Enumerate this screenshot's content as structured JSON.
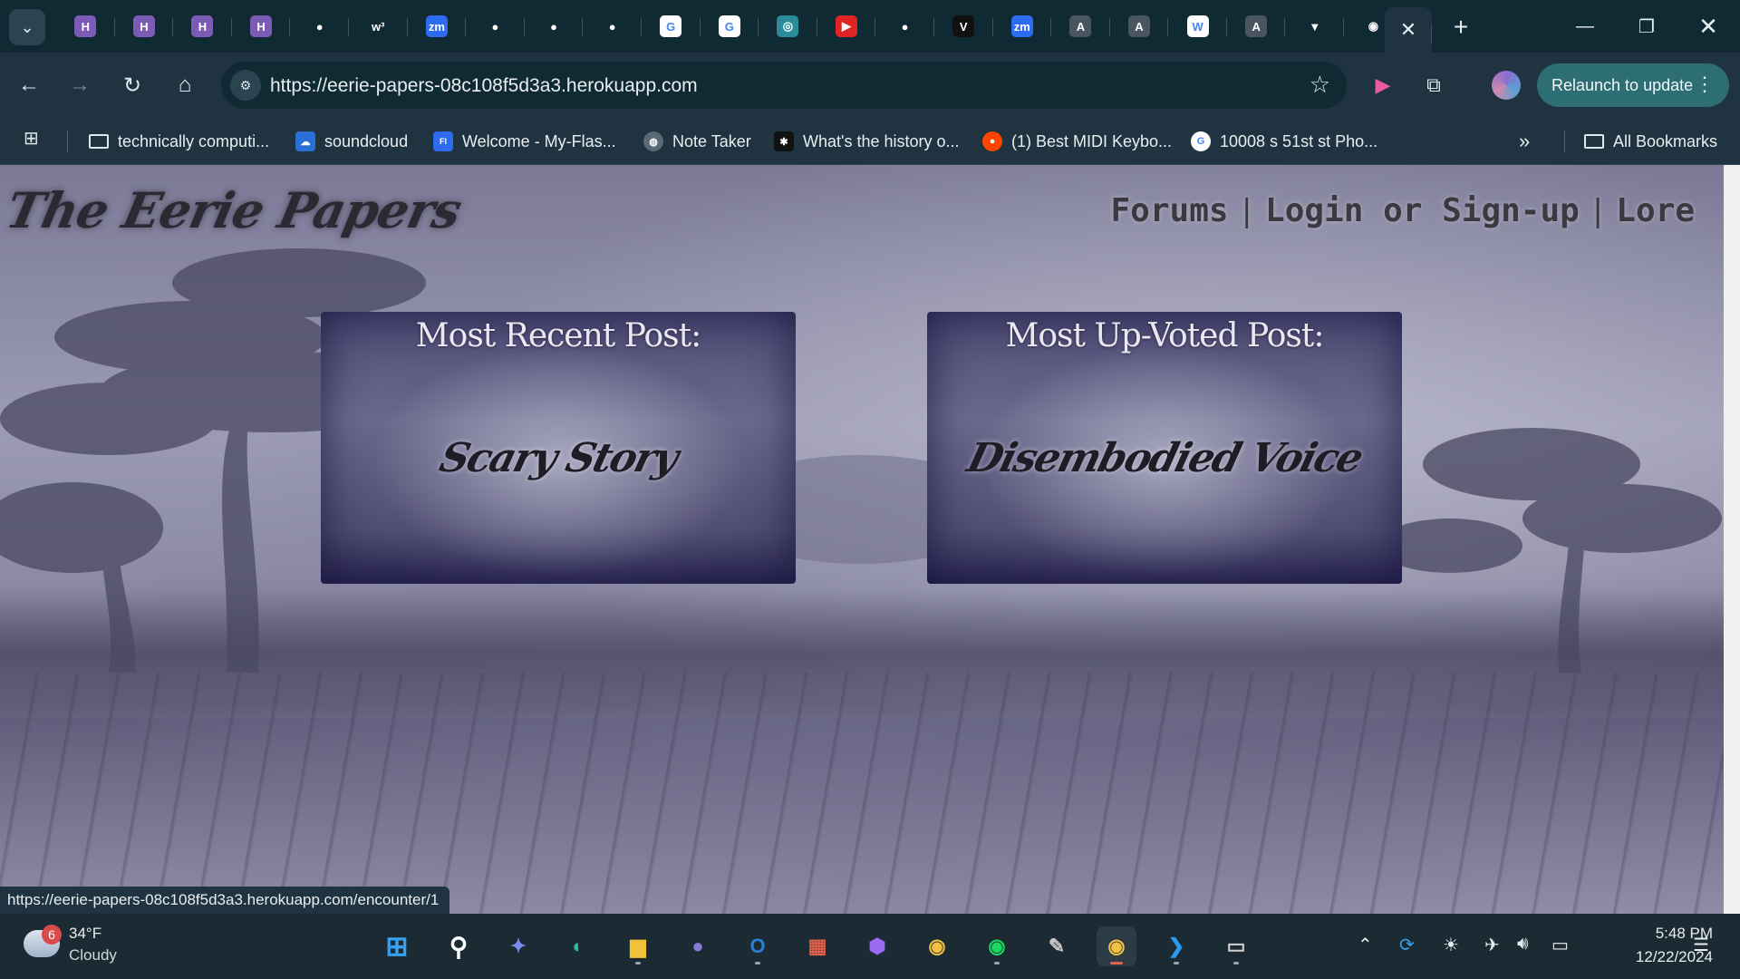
{
  "browser": {
    "tabs": [
      {
        "icon": "heroku-icon",
        "glyph": "H",
        "bg": "#7a5bb5"
      },
      {
        "icon": "heroku-icon",
        "glyph": "H",
        "bg": "#7a5bb5"
      },
      {
        "icon": "heroku-icon",
        "glyph": "H",
        "bg": "#7a5bb5"
      },
      {
        "icon": "heroku-icon",
        "glyph": "H",
        "bg": "#7a5bb5"
      },
      {
        "icon": "github-icon",
        "glyph": "●",
        "bg": "#0f2a33"
      },
      {
        "icon": "w3-icon",
        "glyph": "w³",
        "bg": "#0f2a33"
      },
      {
        "icon": "zoom-icon",
        "glyph": "zm",
        "bg": "#2d6cf0"
      },
      {
        "icon": "github-icon",
        "glyph": "●",
        "bg": "#0f2a33"
      },
      {
        "icon": "github-icon",
        "glyph": "●",
        "bg": "#0f2a33"
      },
      {
        "icon": "github-icon",
        "glyph": "●",
        "bg": "#0f2a33"
      },
      {
        "icon": "google-icon",
        "glyph": "G",
        "bg": "#ffffff"
      },
      {
        "icon": "google-icon",
        "glyph": "G",
        "bg": "#ffffff"
      },
      {
        "icon": "chatgpt-icon",
        "glyph": "◎",
        "bg": "#2a8c9a"
      },
      {
        "icon": "youtube-icon",
        "glyph": "▶",
        "bg": "#e02424"
      },
      {
        "icon": "github-icon",
        "glyph": "●",
        "bg": "#0f2a33"
      },
      {
        "icon": "v-logo-icon",
        "glyph": "V",
        "bg": "#111111"
      },
      {
        "icon": "zoom-icon",
        "glyph": "zm",
        "bg": "#2d6cf0"
      },
      {
        "icon": "a-circle-icon",
        "glyph": "A",
        "bg": "#4a5560"
      },
      {
        "icon": "a-circle-icon",
        "glyph": "A",
        "bg": "#4a5560"
      },
      {
        "icon": "wikipedia-icon",
        "glyph": "W",
        "bg": "#ffffff"
      },
      {
        "icon": "a-circle-icon",
        "glyph": "A",
        "bg": "#4a5560"
      },
      {
        "icon": "vite-icon",
        "glyph": "▼",
        "bg": "#0f2a33"
      },
      {
        "icon": "chrome-icon",
        "glyph": "◉",
        "bg": "#0f2a33"
      }
    ],
    "url": "https://eerie-papers-08c108f5d3a3.herokuapp.com",
    "relaunch_label": "Relaunch to update",
    "bookmarks": [
      {
        "label": "technically computi...",
        "icon": "folder-icon"
      },
      {
        "label": "soundcloud",
        "icon": "soundcloud-icon"
      },
      {
        "label": "Welcome - My-Flas...",
        "icon": "flask-icon"
      },
      {
        "label": "Note Taker",
        "icon": "globe-icon"
      },
      {
        "label": "What's the history o...",
        "icon": "site-icon"
      },
      {
        "label": "(1) Best MIDI Keybo...",
        "icon": "reddit-icon"
      },
      {
        "label": "10008 s 51st st Pho...",
        "icon": "google-icon"
      }
    ],
    "all_bookmarks_label": "All Bookmarks",
    "status_url": "https://eerie-papers-08c108f5d3a3.herokuapp.com/encounter/1"
  },
  "page": {
    "site_title": "The Eerie Papers",
    "nav": {
      "forums": "Forums",
      "sep1": "|",
      "login": "Login or Sign-up",
      "sep2": "|",
      "lore": "Lore"
    },
    "cards": [
      {
        "heading": "Most Recent Post:",
        "title": "Scary Story"
      },
      {
        "heading": "Most Up-Voted Post:",
        "title": "Disembodied Voice"
      }
    ]
  },
  "taskbar": {
    "weather_badge": "6",
    "temperature": "34°F",
    "condition": "Cloudy",
    "time": "5:48 PM",
    "date": "12/22/2024"
  }
}
